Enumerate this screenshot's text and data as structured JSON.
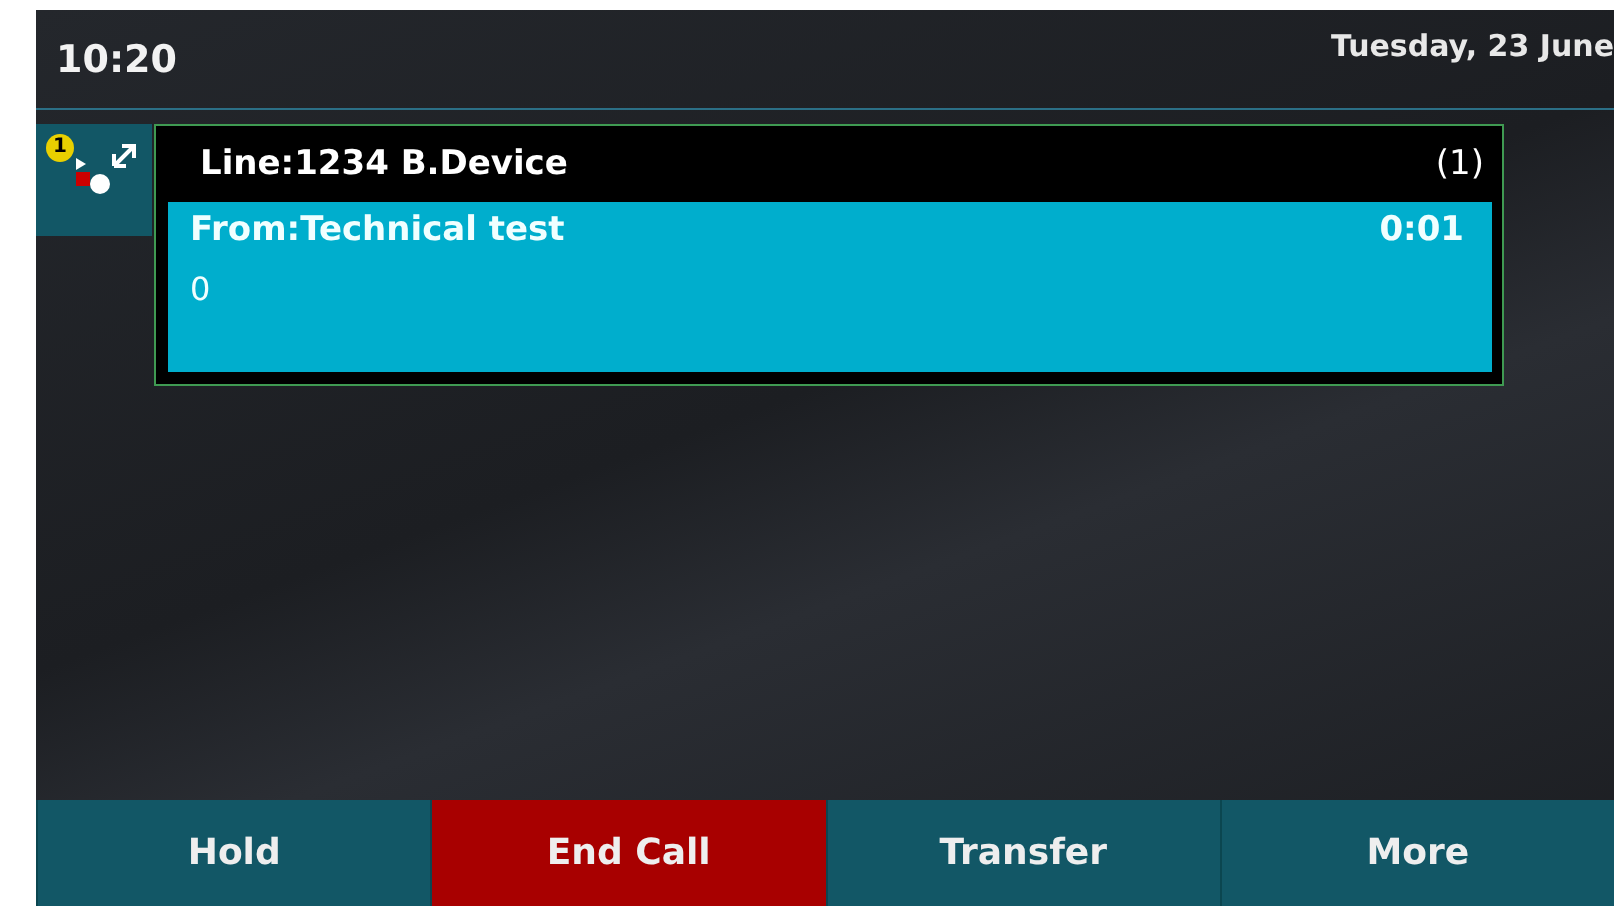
{
  "status_bar": {
    "time": "10:20",
    "date": "Tuesday, 23 June"
  },
  "line": {
    "badge": "1",
    "label": "Line:1234 B.Device",
    "count": "(1)"
  },
  "call": {
    "from": "From:Technical test",
    "duration": "0:01",
    "number": "0",
    "selected": true
  },
  "softkeys": [
    {
      "label": "Hold",
      "kind": "normal"
    },
    {
      "label": "End Call",
      "kind": "end"
    },
    {
      "label": "Transfer",
      "kind": "normal"
    },
    {
      "label": "More",
      "kind": "normal"
    }
  ]
}
